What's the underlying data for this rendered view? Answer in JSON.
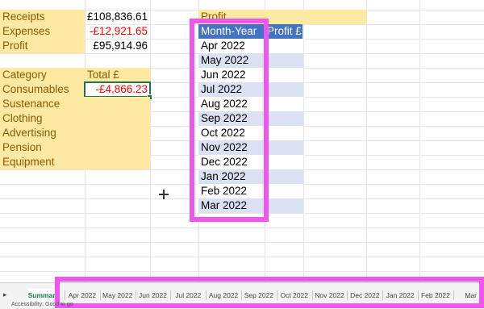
{
  "summary": {
    "receipts_label": "Receipts",
    "receipts_value": "£108,836.61",
    "expenses_label": "Expenses",
    "expenses_value": "-£12,921.65",
    "profit_label": "Profit",
    "profit_value": "£95,914.96"
  },
  "category_table": {
    "header_category": "Category",
    "header_total": "Total £",
    "rows": [
      {
        "category": "Consumables",
        "total": "-£4,866.23"
      },
      {
        "category": "Sustenance",
        "total": ""
      },
      {
        "category": "Clothing",
        "total": ""
      },
      {
        "category": "Advertising",
        "total": ""
      },
      {
        "category": "Pension",
        "total": ""
      },
      {
        "category": "Equipment",
        "total": ""
      }
    ]
  },
  "profit_table": {
    "title": "Profit",
    "header_month": "Month-Year",
    "header_profit": "Profit £",
    "months": [
      "Apr 2022",
      "May 2022",
      "Jun 2022",
      "Jul 2022",
      "Aug 2022",
      "Sep 2022",
      "Oct 2022",
      "Nov 2022",
      "Dec 2022",
      "Jan 2022",
      "Feb 2022",
      "Mar 2022"
    ]
  },
  "sheet_tabs": {
    "active": "Summary",
    "items": [
      "Apr 2022",
      "May 2022",
      "Jun 2022",
      "Jul 2022",
      "Aug 2022",
      "Sep 2022",
      "Oct 2022",
      "Nov 2022",
      "Dec 2022",
      "Jan 2022",
      "Feb 2022",
      "Mar"
    ],
    "more": "..."
  },
  "status_bar": {
    "accessibility": "Accessibility: Good to go"
  },
  "colors": {
    "highlight_yellow": "#fde9a2",
    "table_header_blue": "#4472c4",
    "table_band": "#d9e1f2",
    "negative_red": "#ff0000",
    "selection_green": "#217346",
    "annotation_pink": "#f055f0"
  },
  "icons": {
    "cursor": "crosshair-cursor-icon",
    "tab_nav": "triangle-right-icon"
  }
}
